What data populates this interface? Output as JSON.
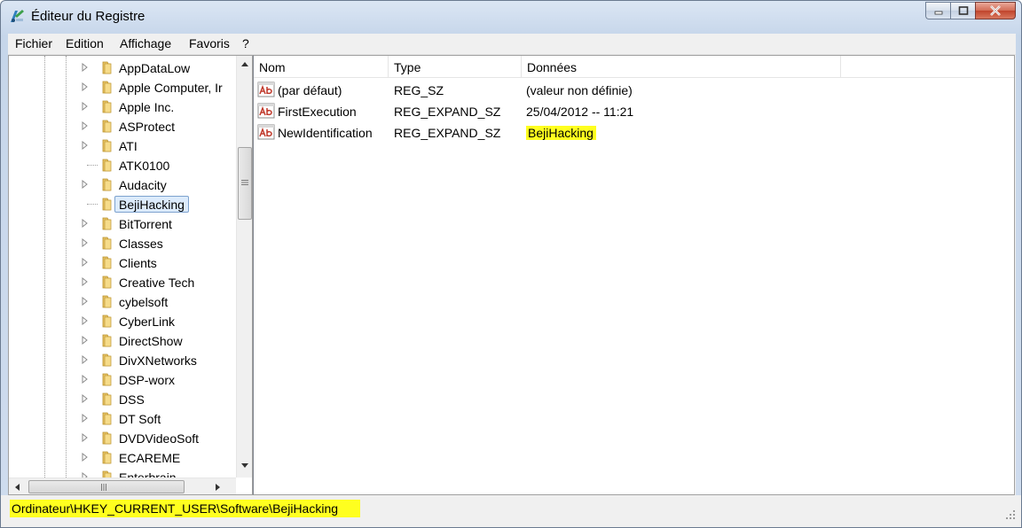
{
  "window": {
    "title": "Éditeur du Registre",
    "accent_color": "#c0442c"
  },
  "menu": [
    {
      "label": "Fichier"
    },
    {
      "label": "Edition"
    },
    {
      "label": "Affichage"
    },
    {
      "label": "Favoris"
    },
    {
      "label": "?"
    }
  ],
  "tree": {
    "items": [
      {
        "label": "AppDataLow",
        "expandable": true,
        "selected": false
      },
      {
        "label": "Apple Computer, Ir",
        "expandable": true,
        "selected": false
      },
      {
        "label": "Apple Inc.",
        "expandable": true,
        "selected": false
      },
      {
        "label": "ASProtect",
        "expandable": true,
        "selected": false
      },
      {
        "label": "ATI",
        "expandable": true,
        "selected": false
      },
      {
        "label": "ATK0100",
        "expandable": false,
        "selected": false
      },
      {
        "label": "Audacity",
        "expandable": true,
        "selected": false
      },
      {
        "label": "BejiHacking",
        "expandable": false,
        "selected": true
      },
      {
        "label": "BitTorrent",
        "expandable": true,
        "selected": false
      },
      {
        "label": "Classes",
        "expandable": true,
        "selected": false
      },
      {
        "label": "Clients",
        "expandable": true,
        "selected": false
      },
      {
        "label": "Creative Tech",
        "expandable": true,
        "selected": false
      },
      {
        "label": "cybelsoft",
        "expandable": true,
        "selected": false
      },
      {
        "label": "CyberLink",
        "expandable": true,
        "selected": false
      },
      {
        "label": "DirectShow",
        "expandable": true,
        "selected": false
      },
      {
        "label": "DivXNetworks",
        "expandable": true,
        "selected": false
      },
      {
        "label": "DSP-worx",
        "expandable": true,
        "selected": false
      },
      {
        "label": "DSS",
        "expandable": true,
        "selected": false
      },
      {
        "label": "DT Soft",
        "expandable": true,
        "selected": false
      },
      {
        "label": "DVDVideoSoft",
        "expandable": true,
        "selected": false
      },
      {
        "label": "ECAREME",
        "expandable": true,
        "selected": false
      },
      {
        "label": "Enterbrain",
        "expandable": true,
        "selected": false
      }
    ]
  },
  "list": {
    "columns": [
      {
        "label": "Nom"
      },
      {
        "label": "Type"
      },
      {
        "label": "Données"
      }
    ],
    "rows": [
      {
        "name": "(par défaut)",
        "type": "REG_SZ",
        "data": "(valeur non définie)",
        "highlight": false
      },
      {
        "name": "FirstExecution",
        "type": "REG_EXPAND_SZ",
        "data": "25/04/2012 -- 11:21",
        "highlight": false
      },
      {
        "name": "NewIdentification",
        "type": "REG_EXPAND_SZ",
        "data": "BejiHacking",
        "highlight": true
      }
    ]
  },
  "status": {
    "path": "Ordinateur\\HKEY_CURRENT_USER\\Software\\BejiHacking",
    "highlight_color": "#ffff1f"
  },
  "icons": {
    "app": "registry-editor-icon",
    "folder": "folder-icon",
    "value": "string-value-ab-icon"
  }
}
